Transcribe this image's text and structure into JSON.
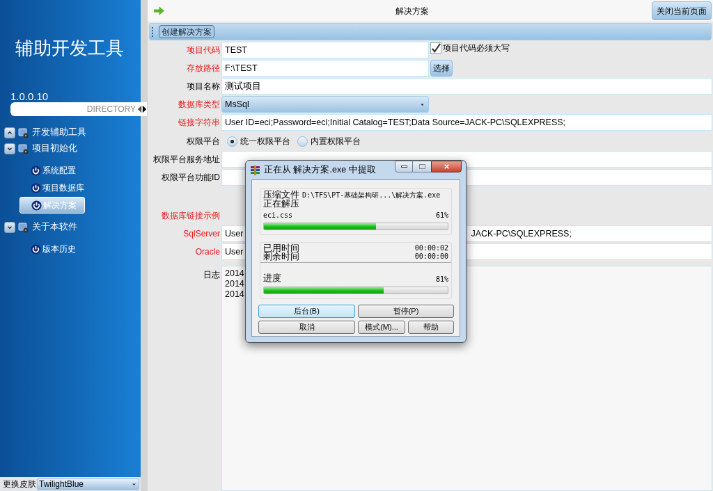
{
  "sidebar": {
    "title": "辅助开发工具",
    "version": "1.0.0.10",
    "directory": "DIRECTORY",
    "tree": [
      {
        "label": "开发辅助工具",
        "expanded": false
      },
      {
        "label": "项目初始化",
        "expanded": true,
        "children": [
          {
            "label": "系统配置",
            "selected": false
          },
          {
            "label": "项目数据库",
            "selected": false
          },
          {
            "label": "解决方案",
            "selected": true
          }
        ]
      },
      {
        "label": "关于本软件",
        "expanded": true,
        "children": [
          {
            "label": "版本历史",
            "selected": false
          }
        ]
      }
    ],
    "skin_label": "更换皮肤",
    "skin_value": "TwilightBlue"
  },
  "header": {
    "title": "解决方案",
    "close_button": "关闭当前页面"
  },
  "toolbar": {
    "buttons": [
      "创建解决方案"
    ]
  },
  "form": {
    "rows": [
      {
        "kind": "text",
        "label": "项目代码",
        "required": true,
        "value": "TEST",
        "checkbox": {
          "label": "项目代码必须大写",
          "checked": true
        }
      },
      {
        "kind": "text",
        "label": "存放路径",
        "required": true,
        "value": "F:\\TEST",
        "button": "选择"
      },
      {
        "kind": "text",
        "label": "项目名称",
        "required": false,
        "value": "测试项目"
      },
      {
        "kind": "select",
        "label": "数据库类型",
        "required": true,
        "value": "MsSql"
      },
      {
        "kind": "text",
        "label": "链接字符串",
        "required": true,
        "value": "User ID=eci;Password=eci;Initial Catalog=TEST;Data Source=JACK-PC\\SQLEXPRESS;"
      },
      {
        "kind": "radio",
        "label": "权限平台",
        "required": false,
        "options": [
          {
            "label": "统一权限平台",
            "selected": true
          },
          {
            "label": "内置权限平台",
            "selected": false
          }
        ]
      },
      {
        "kind": "text",
        "label": "权限平台服务地址",
        "required": false
      },
      {
        "kind": "text",
        "label": "权限平台功能ID",
        "required": false
      },
      {
        "kind": "heading",
        "label": "数据库链接示例",
        "required": true
      },
      {
        "kind": "text",
        "label": "SqlServer",
        "required": true,
        "value": "User",
        "value_end": "JACK-PC\\SQLEXPRESS;"
      },
      {
        "kind": "text",
        "label": "Oracle",
        "required": true,
        "value": "User"
      },
      {
        "kind": "memo",
        "label": "日志",
        "required": false,
        "lines": [
          "2014",
          "2014",
          "2014"
        ]
      }
    ]
  },
  "dialog": {
    "title": "正在从 解决方案.exe 中提取",
    "archive_label": "压缩文件",
    "archive_path": "D:\\TFS\\PT-基础架构研...\\解决方案.exe",
    "status": "正在解压",
    "file": "eci.css",
    "file_progress": {
      "percent": "61%",
      "level": 0.61
    },
    "elapsed_label": "已用时间",
    "elapsed": "00:00:02",
    "remaining_label": "剩余时间",
    "remaining": "00:00:00",
    "progress_label": "进度",
    "total_progress": {
      "percent": "81%",
      "level": 0.65
    },
    "buttons": [
      {
        "label": "后台(B)",
        "focused": true
      },
      {
        "label": "暂停(P)",
        "focused": false
      },
      {
        "label": "取消",
        "focused": false
      },
      {
        "label": "模式(M)...",
        "focused": false
      },
      {
        "label": "帮助",
        "focused": false
      }
    ]
  }
}
